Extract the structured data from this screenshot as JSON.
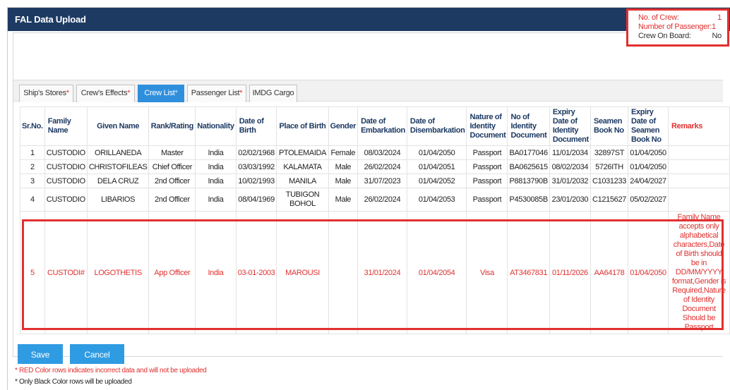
{
  "window": {
    "title": "FAL Data Upload"
  },
  "counts": {
    "crew_label": "No. of Crew:",
    "crew_value": "1",
    "passenger_label": "Number of Passenger:1",
    "onboard_label": "Crew On Board:",
    "onboard_value": "No"
  },
  "tabs": [
    {
      "label": "Ship's Stores",
      "required": "*"
    },
    {
      "label": "Crew's Effects",
      "required": "*"
    },
    {
      "label": "Crew List",
      "required": "*"
    },
    {
      "label": "Passenger List",
      "required": "*"
    },
    {
      "label": "IMDG Cargo",
      "required": ""
    }
  ],
  "table": {
    "headers": [
      "Sr.No.",
      "Family Name",
      "Given Name",
      "Rank/Rating",
      "Nationality",
      "Date of Birth",
      "Place of Birth",
      "Gender",
      "Date of Embarkation",
      "Date of Disembarkation",
      "Nature of Identity Document",
      "No of Identity Document",
      "Expiry Date of Identity Document",
      "Seamen Book No",
      "Expiry Date of Seamen Book No",
      "Remarks"
    ],
    "rows": [
      [
        "1",
        "CUSTODIO",
        "ORILLANEDA",
        "Master",
        "India",
        "02/02/1968",
        "PTOLEMAIDA",
        "Female",
        "08/03/2024",
        "01/04/2050",
        "Passport",
        "BA0177046",
        "11/01/2034",
        "32897ST",
        "01/04/2050",
        ""
      ],
      [
        "2",
        "CUSTODIO",
        "CHRISTOFILEAS",
        "Chief Officer",
        "India",
        "03/03/1992",
        "KALAMATA",
        "Male",
        "26/02/2024",
        "01/04/2051",
        "Passport",
        "BA0625615",
        "08/02/2034",
        "5726ITH",
        "01/04/2050",
        ""
      ],
      [
        "3",
        "CUSTODIO",
        "DELA CRUZ",
        "2nd Officer",
        "India",
        "10/02/1993",
        "MANILA",
        "Male",
        "31/07/2023",
        "01/04/2052",
        "Passport",
        "P8813790B",
        "31/01/2032",
        "C1031233",
        "24/04/2027",
        ""
      ],
      [
        "4",
        "CUSTODIO",
        "LIBARIOS",
        "2nd Officer",
        "India",
        "08/04/1969",
        "TUBIGON BOHOL",
        "Male",
        "26/02/2024",
        "01/04/2053",
        "Passport",
        "P4530085B",
        "23/01/2030",
        "C1215627",
        "05/02/2027",
        ""
      ],
      [
        "5",
        "CUSTODI#",
        "LOGOTHETIS",
        "App Officer",
        "India",
        "03-01-2003",
        "MAROUSI",
        "",
        "31/01/2024",
        "01/04/2054",
        "Visa",
        "AT3467831",
        "01/11/2026",
        "AA64178",
        "01/04/2050",
        "Family Name accepts only alphabetical characters,Date of Birth should be in DD/MM/YYYY format,Gender is Required,Nature of Identity Document Should be Passport"
      ]
    ]
  },
  "buttons": {
    "save": "Save",
    "cancel": "Cancel"
  },
  "notes": {
    "red": "* RED Color rows indicates incorrect data and will not be uploaded",
    "black": "* Only Black Color rows will be uploaded"
  },
  "colors": {
    "header_bg": "#1d3a63",
    "accent": "#2f8fdc",
    "error": "#e03131"
  }
}
